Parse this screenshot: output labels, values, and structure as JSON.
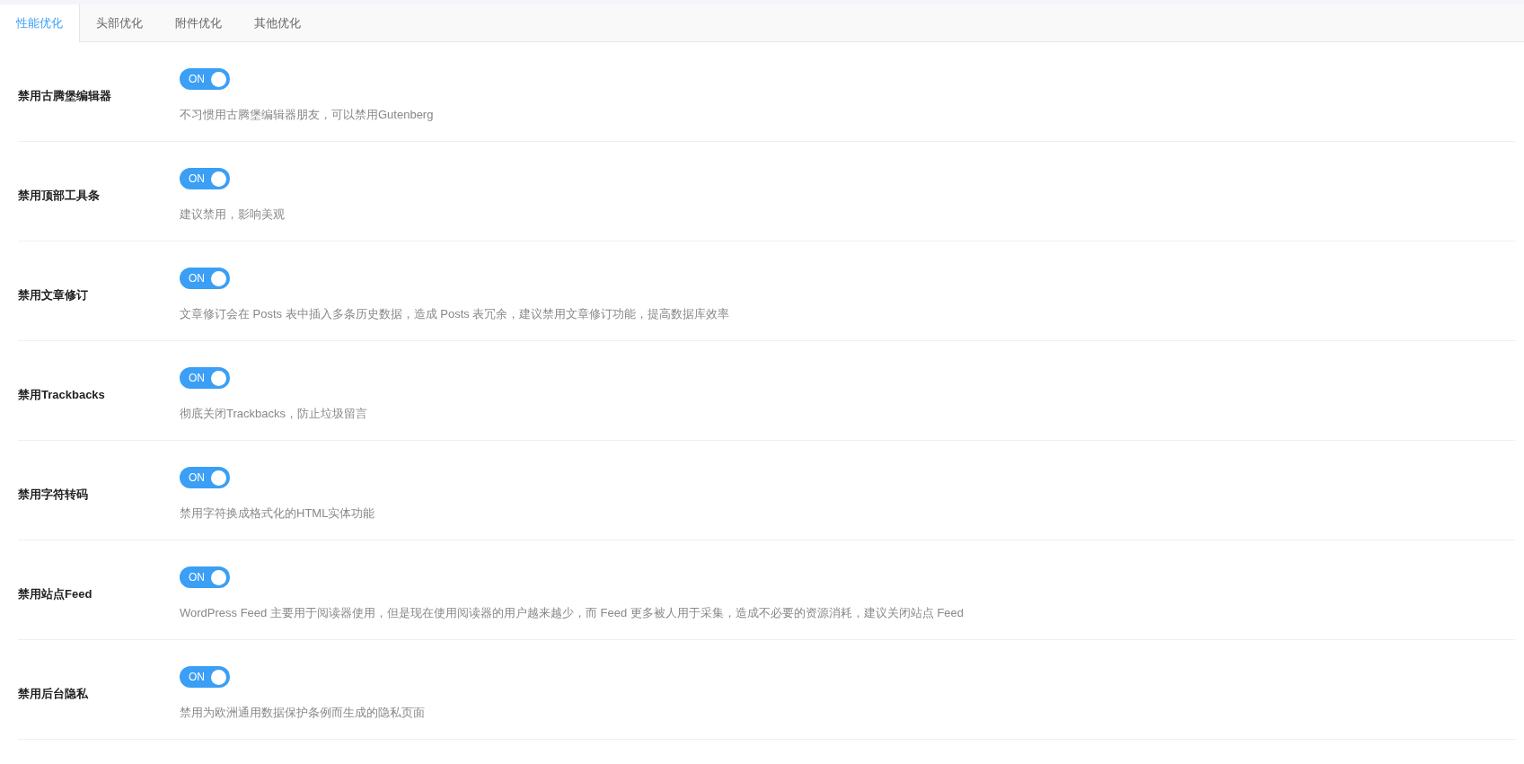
{
  "tabs": [
    {
      "label": "性能优化",
      "selected": true
    },
    {
      "label": "头部优化",
      "selected": false
    },
    {
      "label": "附件优化",
      "selected": false
    },
    {
      "label": "其他优化",
      "selected": false
    }
  ],
  "settings": [
    {
      "label": "禁用古腾堡编辑器",
      "toggle_text": "ON",
      "on": true,
      "description": "不习惯用古腾堡编辑器朋友，可以禁用Gutenberg"
    },
    {
      "label": "禁用顶部工具条",
      "toggle_text": "ON",
      "on": true,
      "description": "建议禁用，影响美观"
    },
    {
      "label": "禁用文章修订",
      "toggle_text": "ON",
      "on": true,
      "description": "文章修订会在 Posts 表中插入多条历史数据，造成 Posts 表冗余，建议禁用文章修订功能，提高数据库效率"
    },
    {
      "label": "禁用Trackbacks",
      "toggle_text": "ON",
      "on": true,
      "description": "彻底关闭Trackbacks，防止垃圾留言"
    },
    {
      "label": "禁用字符转码",
      "toggle_text": "ON",
      "on": true,
      "description": "禁用字符换成格式化的HTML实体功能"
    },
    {
      "label": "禁用站点Feed",
      "toggle_text": "ON",
      "on": true,
      "description": "WordPress Feed 主要用于阅读器使用，但是现在使用阅读器的用户越来越少，而 Feed 更多被人用于采集，造成不必要的资源消耗，建议关闭站点 Feed"
    },
    {
      "label": "禁用后台隐私",
      "toggle_text": "ON",
      "on": true,
      "description": "禁用为欧洲通用数据保护条例而生成的隐私页面"
    }
  ]
}
